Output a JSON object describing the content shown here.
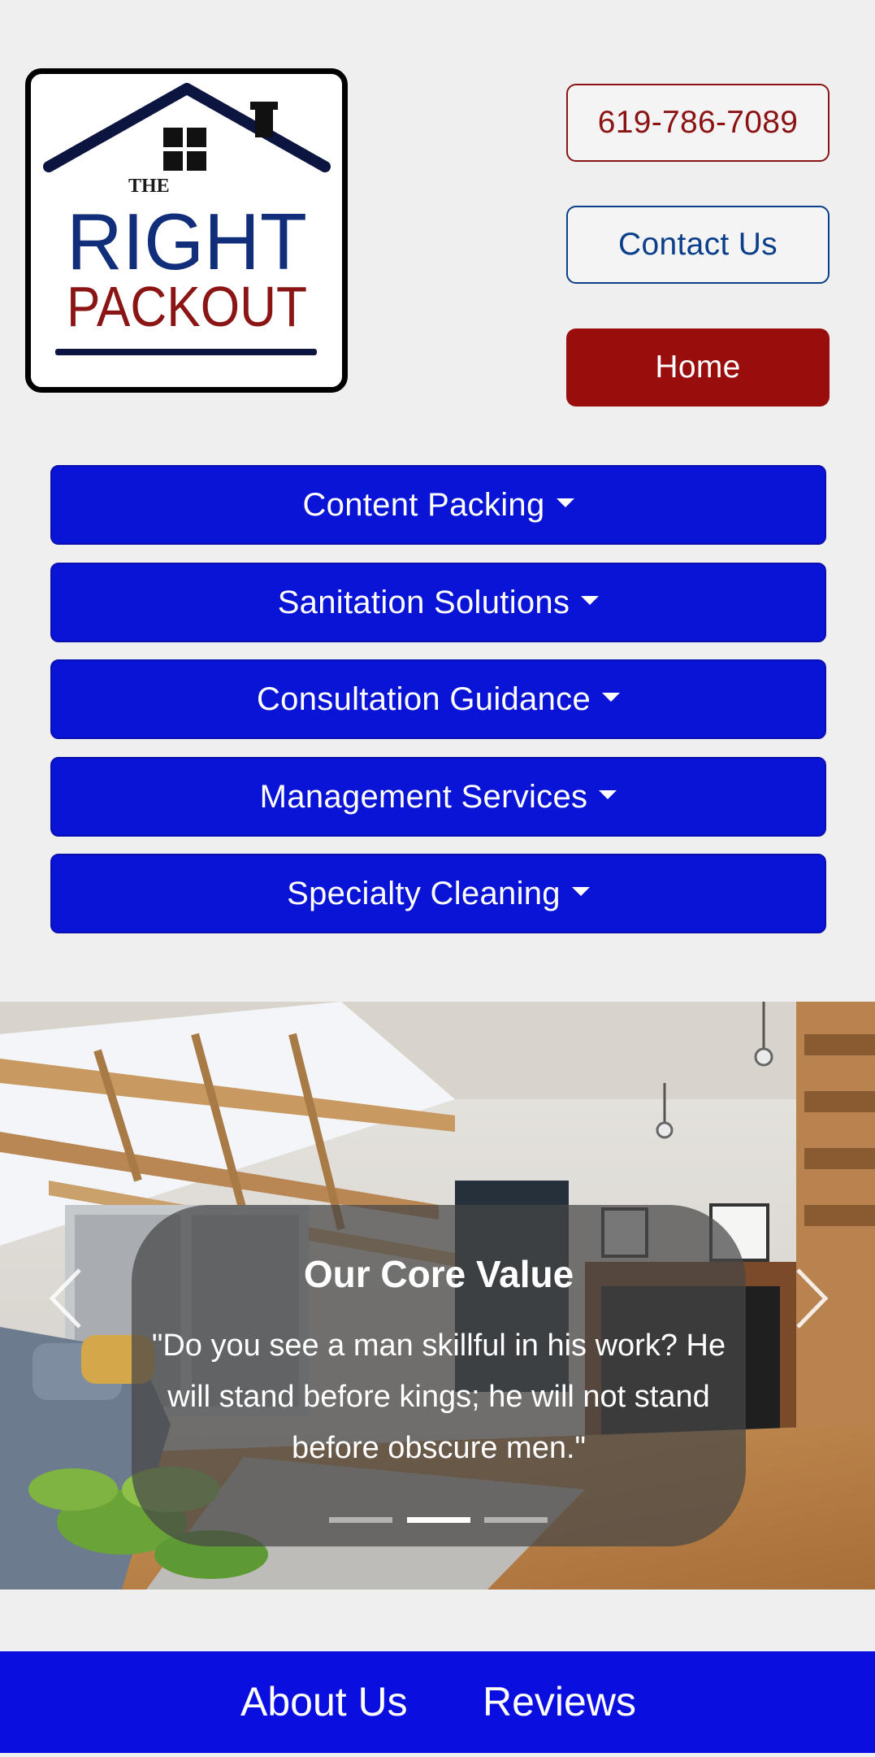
{
  "header": {
    "logo": {
      "line1": "THE",
      "line2": "RIGHT",
      "line3": "PACKOUT"
    },
    "phone_label": "619-786-7089",
    "contact_label": "Contact Us",
    "home_label": "Home"
  },
  "nav": {
    "items": [
      {
        "label": "Content Packing"
      },
      {
        "label": "Sanitation Solutions"
      },
      {
        "label": "Consultation Guidance"
      },
      {
        "label": "Management Services"
      },
      {
        "label": "Specialty Cleaning"
      }
    ]
  },
  "carousel": {
    "caption_title": "Our Core Value",
    "caption_text": "\"Do you see a man skillful in his work? He will stand before kings; he will not stand before obscure men.\"",
    "slide_count": 3,
    "active_index": 1
  },
  "footer": {
    "links": [
      {
        "label": "About Us"
      },
      {
        "label": "Reviews"
      }
    ]
  },
  "colors": {
    "page_bg": "#efefef",
    "nav_blue": "#0a14d6",
    "brand_red": "#9a0d0d",
    "brand_navy": "#0b3f8a",
    "footer_blue": "#0a0fe0"
  },
  "icons": {
    "logo": "house-roof-logo",
    "carousel_prev": "chevron-left-icon",
    "carousel_next": "chevron-right-icon",
    "dropdown": "caret-down-icon"
  }
}
